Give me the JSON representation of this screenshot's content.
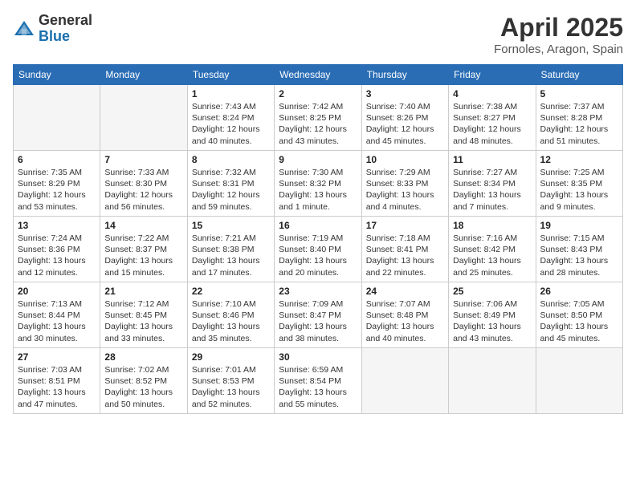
{
  "header": {
    "logo_general": "General",
    "logo_blue": "Blue",
    "month_year": "April 2025",
    "location": "Fornoles, Aragon, Spain"
  },
  "days_of_week": [
    "Sunday",
    "Monday",
    "Tuesday",
    "Wednesday",
    "Thursday",
    "Friday",
    "Saturday"
  ],
  "weeks": [
    [
      {
        "day": "",
        "info": ""
      },
      {
        "day": "",
        "info": ""
      },
      {
        "day": "1",
        "info": "Sunrise: 7:43 AM\nSunset: 8:24 PM\nDaylight: 12 hours and 40 minutes."
      },
      {
        "day": "2",
        "info": "Sunrise: 7:42 AM\nSunset: 8:25 PM\nDaylight: 12 hours and 43 minutes."
      },
      {
        "day": "3",
        "info": "Sunrise: 7:40 AM\nSunset: 8:26 PM\nDaylight: 12 hours and 45 minutes."
      },
      {
        "day": "4",
        "info": "Sunrise: 7:38 AM\nSunset: 8:27 PM\nDaylight: 12 hours and 48 minutes."
      },
      {
        "day": "5",
        "info": "Sunrise: 7:37 AM\nSunset: 8:28 PM\nDaylight: 12 hours and 51 minutes."
      }
    ],
    [
      {
        "day": "6",
        "info": "Sunrise: 7:35 AM\nSunset: 8:29 PM\nDaylight: 12 hours and 53 minutes."
      },
      {
        "day": "7",
        "info": "Sunrise: 7:33 AM\nSunset: 8:30 PM\nDaylight: 12 hours and 56 minutes."
      },
      {
        "day": "8",
        "info": "Sunrise: 7:32 AM\nSunset: 8:31 PM\nDaylight: 12 hours and 59 minutes."
      },
      {
        "day": "9",
        "info": "Sunrise: 7:30 AM\nSunset: 8:32 PM\nDaylight: 13 hours and 1 minute."
      },
      {
        "day": "10",
        "info": "Sunrise: 7:29 AM\nSunset: 8:33 PM\nDaylight: 13 hours and 4 minutes."
      },
      {
        "day": "11",
        "info": "Sunrise: 7:27 AM\nSunset: 8:34 PM\nDaylight: 13 hours and 7 minutes."
      },
      {
        "day": "12",
        "info": "Sunrise: 7:25 AM\nSunset: 8:35 PM\nDaylight: 13 hours and 9 minutes."
      }
    ],
    [
      {
        "day": "13",
        "info": "Sunrise: 7:24 AM\nSunset: 8:36 PM\nDaylight: 13 hours and 12 minutes."
      },
      {
        "day": "14",
        "info": "Sunrise: 7:22 AM\nSunset: 8:37 PM\nDaylight: 13 hours and 15 minutes."
      },
      {
        "day": "15",
        "info": "Sunrise: 7:21 AM\nSunset: 8:38 PM\nDaylight: 13 hours and 17 minutes."
      },
      {
        "day": "16",
        "info": "Sunrise: 7:19 AM\nSunset: 8:40 PM\nDaylight: 13 hours and 20 minutes."
      },
      {
        "day": "17",
        "info": "Sunrise: 7:18 AM\nSunset: 8:41 PM\nDaylight: 13 hours and 22 minutes."
      },
      {
        "day": "18",
        "info": "Sunrise: 7:16 AM\nSunset: 8:42 PM\nDaylight: 13 hours and 25 minutes."
      },
      {
        "day": "19",
        "info": "Sunrise: 7:15 AM\nSunset: 8:43 PM\nDaylight: 13 hours and 28 minutes."
      }
    ],
    [
      {
        "day": "20",
        "info": "Sunrise: 7:13 AM\nSunset: 8:44 PM\nDaylight: 13 hours and 30 minutes."
      },
      {
        "day": "21",
        "info": "Sunrise: 7:12 AM\nSunset: 8:45 PM\nDaylight: 13 hours and 33 minutes."
      },
      {
        "day": "22",
        "info": "Sunrise: 7:10 AM\nSunset: 8:46 PM\nDaylight: 13 hours and 35 minutes."
      },
      {
        "day": "23",
        "info": "Sunrise: 7:09 AM\nSunset: 8:47 PM\nDaylight: 13 hours and 38 minutes."
      },
      {
        "day": "24",
        "info": "Sunrise: 7:07 AM\nSunset: 8:48 PM\nDaylight: 13 hours and 40 minutes."
      },
      {
        "day": "25",
        "info": "Sunrise: 7:06 AM\nSunset: 8:49 PM\nDaylight: 13 hours and 43 minutes."
      },
      {
        "day": "26",
        "info": "Sunrise: 7:05 AM\nSunset: 8:50 PM\nDaylight: 13 hours and 45 minutes."
      }
    ],
    [
      {
        "day": "27",
        "info": "Sunrise: 7:03 AM\nSunset: 8:51 PM\nDaylight: 13 hours and 47 minutes."
      },
      {
        "day": "28",
        "info": "Sunrise: 7:02 AM\nSunset: 8:52 PM\nDaylight: 13 hours and 50 minutes."
      },
      {
        "day": "29",
        "info": "Sunrise: 7:01 AM\nSunset: 8:53 PM\nDaylight: 13 hours and 52 minutes."
      },
      {
        "day": "30",
        "info": "Sunrise: 6:59 AM\nSunset: 8:54 PM\nDaylight: 13 hours and 55 minutes."
      },
      {
        "day": "",
        "info": ""
      },
      {
        "day": "",
        "info": ""
      },
      {
        "day": "",
        "info": ""
      }
    ]
  ]
}
